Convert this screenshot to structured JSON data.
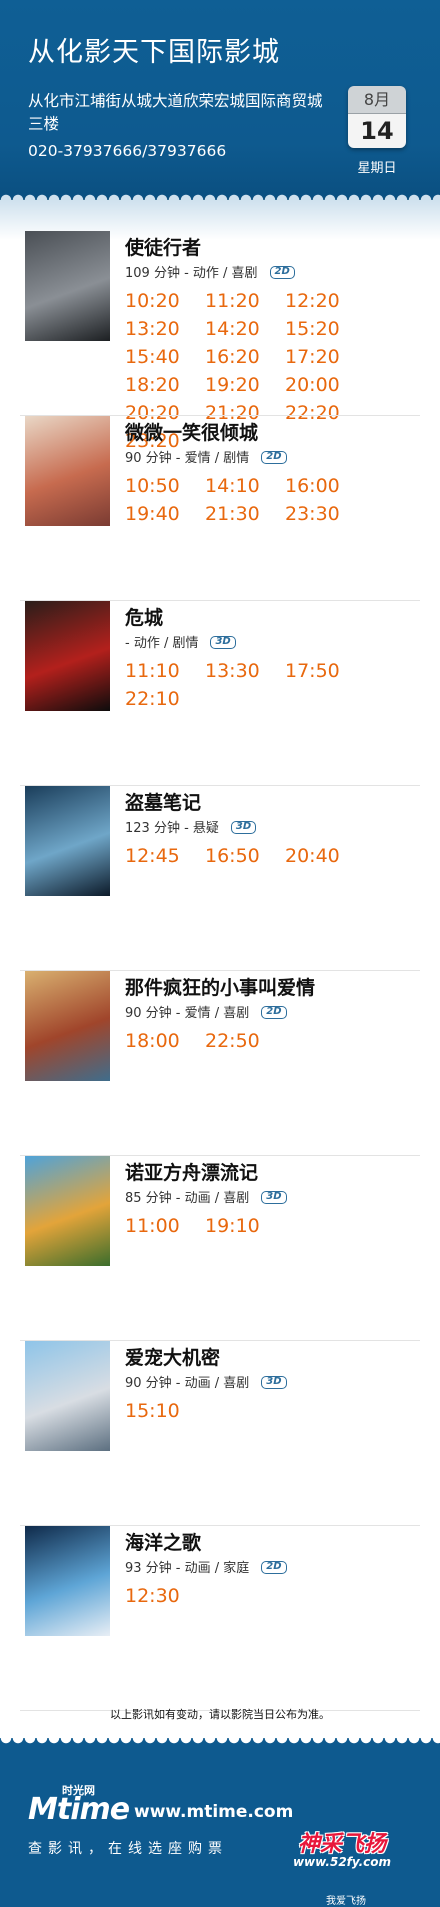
{
  "header": {
    "title": "从化影天下国际影城",
    "address": "从化市江埔街从城大道欣荣宏城国际商贸城三楼",
    "phone": "020-37937666/37937666",
    "date": {
      "month": "8月",
      "day": "14",
      "weekday": "星期日"
    }
  },
  "movies": [
    {
      "title": "使徒行者",
      "meta": "109 分钟 - 动作 / 喜剧",
      "format": "2D",
      "poster_colors": [
        "#4a4f55",
        "#8a8f95",
        "#1c1f22"
      ],
      "times": [
        "10:20",
        "11:20",
        "12:20",
        "13:20",
        "14:20",
        "15:20",
        "15:40",
        "16:20",
        "17:20",
        "18:20",
        "19:20",
        "20:00",
        "20:20",
        "21:20",
        "22:20",
        "23:20"
      ]
    },
    {
      "title": "微微一笑很倾城",
      "meta": "90 分钟 - 爱情 / 剧情",
      "format": "2D",
      "poster_colors": [
        "#e9d7c6",
        "#c76b4f",
        "#7a3b32"
      ],
      "times": [
        "10:50",
        "14:10",
        "16:00",
        "19:40",
        "21:30",
        "23:30"
      ]
    },
    {
      "title": "危城",
      "meta": " - 动作 / 剧情",
      "format": "3D",
      "poster_colors": [
        "#2a1e1a",
        "#b3201c",
        "#0d0c0c"
      ],
      "times": [
        "11:10",
        "13:30",
        "17:50",
        "22:10"
      ]
    },
    {
      "title": "盗墓笔记",
      "meta": "123 分钟 - 悬疑",
      "format": "3D",
      "poster_colors": [
        "#1a3d5a",
        "#6fa6c8",
        "#0c1a29"
      ],
      "times": [
        "12:45",
        "16:50",
        "20:40"
      ]
    },
    {
      "title": "那件疯狂的小事叫爱情",
      "meta": "90 分钟 - 爱情 / 喜剧",
      "format": "2D",
      "poster_colors": [
        "#d9b070",
        "#a0452b",
        "#3f6d8c"
      ],
      "times": [
        "18:00",
        "22:50"
      ]
    },
    {
      "title": "诺亚方舟漂流记",
      "meta": "85 分钟 - 动画 / 喜剧",
      "format": "3D",
      "poster_colors": [
        "#4fa3d9",
        "#e3a43a",
        "#3b6d2c"
      ],
      "times": [
        "11:00",
        "19:10"
      ]
    },
    {
      "title": "爱宠大机密",
      "meta": "90 分钟 - 动画 / 喜剧",
      "format": "3D",
      "poster_colors": [
        "#8ec4e8",
        "#d8dde3",
        "#5c6f80"
      ],
      "times": [
        "15:10"
      ]
    },
    {
      "title": "海洋之歌",
      "meta": "93 分钟 - 动画 / 家庭",
      "format": "2D",
      "poster_colors": [
        "#0f2a4a",
        "#5ea5d6",
        "#e8eef5"
      ],
      "times": [
        "12:30"
      ]
    }
  ],
  "notice": "以上影讯如有变动，请以影院当日公布为准。",
  "footer": {
    "logo_text": "Mtime",
    "logo_cn": "时光网",
    "url": "www.mtime.com",
    "slogan": "查影讯，在线选座购票",
    "brand_cn": "神采飞扬",
    "brand_url": "www.52fy.com",
    "brand_sub": "我爱飞扬"
  }
}
